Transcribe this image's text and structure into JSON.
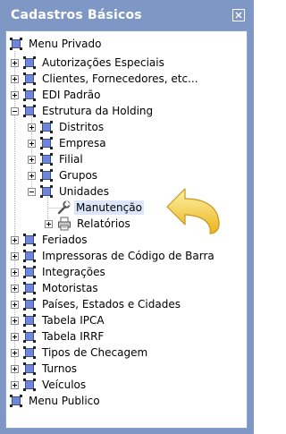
{
  "window": {
    "title": "Cadastros Básicos",
    "close_icon": "close-icon"
  },
  "colors": {
    "title_bar": "#7f97c4",
    "node_icon": "#6f86d8",
    "selected_bg": "#dbe6fb",
    "arrow": "#f3c42f"
  },
  "tree": {
    "root_private": "Menu Privado",
    "autorizacoes": "Autorizações Especiais",
    "clientes": "Clientes, Fornecedores, etc...",
    "edi": "EDI Padrão",
    "estrutura": "Estrutura da Holding",
    "distritos": "Distritos",
    "empresa": "Empresa",
    "filial": "Filial",
    "grupos": "Grupos",
    "unidades": "Unidades",
    "manutencao": "Manutenção",
    "relatorios": "Relatórios",
    "feriados": "Feriados",
    "impressoras": "Impressoras de Código de Barra",
    "integracoes": "Integrações",
    "motoristas": "Motoristas",
    "paises": "Países, Estados e Cidades",
    "ipca": "Tabela IPCA",
    "irrf": "Tabela IRRF",
    "checagem": "Tipos de Checagem",
    "turnos": "Turnos",
    "veiculos": "Veículos",
    "root_public": "Menu Publico"
  },
  "callout": {
    "icon": "curved-arrow-icon"
  }
}
